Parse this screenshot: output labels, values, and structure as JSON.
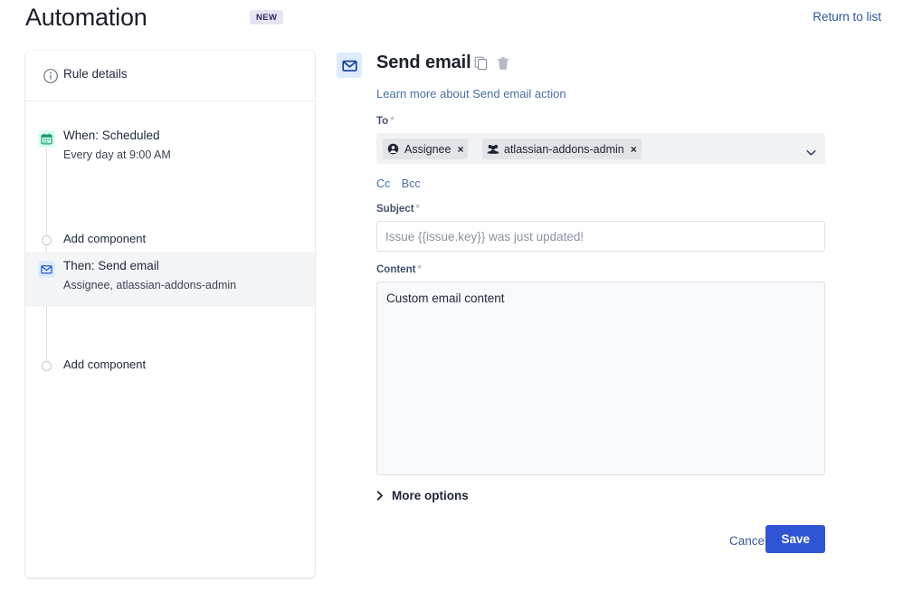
{
  "header": {
    "title": "Automation",
    "badge": "NEW",
    "return_link": "Return to list"
  },
  "sidebar": {
    "rule_details": {
      "label": "Rule details",
      "icon": "info-icon"
    },
    "nodes": [
      {
        "title": "When: Scheduled",
        "subtitle": "Every day at 9:00 AM",
        "icon": "calendar-icon",
        "selected": false
      },
      {
        "title": "Then: Send email",
        "subtitle": "Assignee, atlassian-addons-admin",
        "icon": "envelope-icon",
        "selected": true
      }
    ],
    "add_component_label": "Add component",
    "add_component_label_2": "Add component"
  },
  "main": {
    "icon": "envelope-icon",
    "title": "Send email",
    "copy_action": "copy-icon",
    "delete_action": "trash-icon",
    "learn_more": "Learn more about Send email action",
    "to": {
      "label": "To",
      "required": "*",
      "chips": [
        {
          "label": "Assignee",
          "icon": "person-avatar-icon",
          "remove": "×"
        },
        {
          "label": "atlassian-addons-admin",
          "icon": "group-icon",
          "remove": "×"
        }
      ],
      "chevron": "chevron-down-icon"
    },
    "cc_label": "Cc",
    "bcc_label": "Bcc",
    "subject": {
      "label": "Subject",
      "required": "*",
      "value": "",
      "placeholder": "Issue {{issue.key}} was just updated!"
    },
    "content": {
      "label": "Content",
      "required": "*",
      "value": "Custom email content",
      "placeholder": ""
    },
    "more_options": "More options",
    "cancel_label": "Cancel",
    "save_label": "Save"
  },
  "colors": {
    "accent_blue": "#2f55d4",
    "link_blue": "#2b5598",
    "badge_bg": "#e6e4f5",
    "selected_row": "#f4f5f7",
    "icon_green_bg": "#dcfff1",
    "icon_blue_bg": "#deebff"
  }
}
